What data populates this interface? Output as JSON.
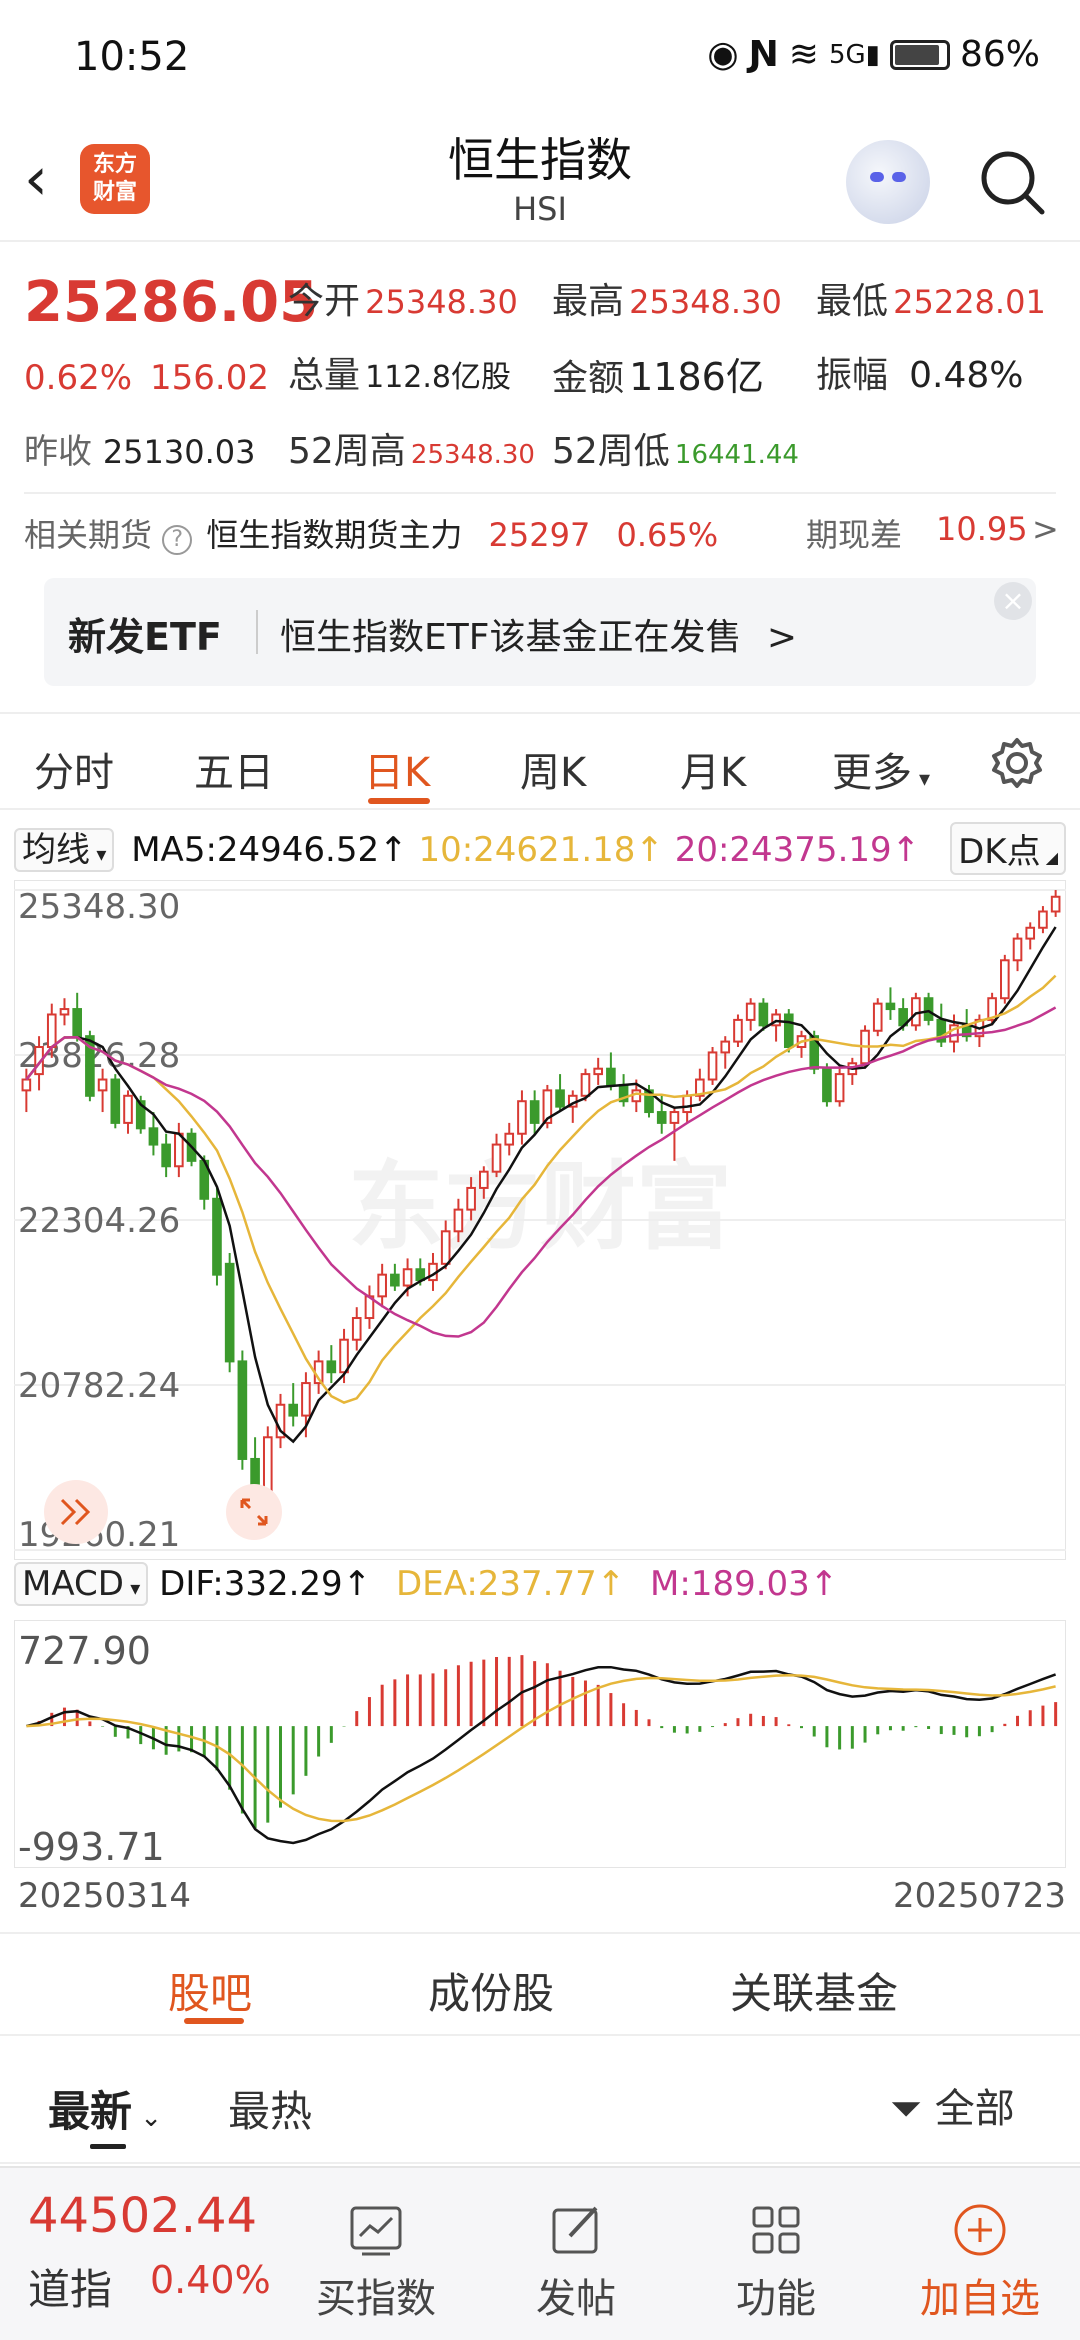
{
  "status": {
    "time": "10:52",
    "battery": "86%",
    "network": "5G"
  },
  "header": {
    "title": "恒生指数",
    "subtitle": "HSI",
    "logo_text": "东方财富"
  },
  "quote": {
    "price": "25286.05",
    "change_pct": "0.62%",
    "change": "156.02",
    "open_label": "今开",
    "open": "25348.30",
    "high_label": "最高",
    "high": "25348.30",
    "low_label": "最低",
    "low": "25228.01",
    "volume_label": "总量",
    "volume": "112.8亿股",
    "amount_label": "金额",
    "amount": "1186亿",
    "amplitude_label": "振幅",
    "amplitude": "0.48%",
    "prev_close_label": "昨收",
    "prev_close": "25130.03",
    "w52_high_label": "52周高",
    "w52_high": "25348.30",
    "w52_low_label": "52周低",
    "w52_low": "16441.44"
  },
  "futures": {
    "label": "相关期货",
    "name": "恒生指数期货主力",
    "price": "25297",
    "pct": "0.65%",
    "basis_label": "期现差",
    "basis": "10.95"
  },
  "etf": {
    "tag": "新发ETF",
    "text": "恒生指数ETF该基金正在发售",
    "arrow": ">"
  },
  "tabs": {
    "items": [
      "分时",
      "五日",
      "日K",
      "周K",
      "月K",
      "更多"
    ],
    "active": "日K"
  },
  "ma": {
    "selector": "均线",
    "ma5": "MA5:24946.52↑",
    "ma10": "10:24621.18↑",
    "ma20": "20:24375.19↑",
    "dk": "DK点",
    "colors": {
      "ma5": "#111111",
      "ma10": "#e6b63a",
      "ma20": "#c2378f"
    }
  },
  "macd": {
    "selector": "MACD",
    "dif": "DIF:332.29↑",
    "dea": "DEA:237.77↑",
    "m": "M:189.03↑"
  },
  "chart_data": [
    {
      "type": "candlestick",
      "title": "",
      "ytick_labels": [
        "25348.30",
        "23826.28",
        "22304.26",
        "20782.24",
        "19260.21"
      ],
      "ylim": [
        19260.21,
        25348.3
      ],
      "x_start": "20250314",
      "x_end": "20250723",
      "watermark": "东方财富",
      "ohlc": [
        [
          23500,
          23700,
          23300,
          23600
        ],
        [
          23650,
          24000,
          23500,
          23900
        ],
        [
          23900,
          24300,
          23800,
          24200
        ],
        [
          24200,
          24350,
          24100,
          24250
        ],
        [
          24250,
          24400,
          23950,
          24000
        ],
        [
          24000,
          24050,
          23400,
          23450
        ],
        [
          23500,
          23700,
          23300,
          23600
        ],
        [
          23600,
          23650,
          23150,
          23200
        ],
        [
          23200,
          23500,
          23100,
          23450
        ],
        [
          23400,
          23450,
          23100,
          23150
        ],
        [
          23150,
          23300,
          22900,
          23000
        ],
        [
          23000,
          23100,
          22700,
          22800
        ],
        [
          22800,
          23200,
          22700,
          23100
        ],
        [
          23100,
          23150,
          22800,
          22850
        ],
        [
          22850,
          22900,
          22400,
          22500
        ],
        [
          22500,
          22600,
          21700,
          21800
        ],
        [
          21900,
          22000,
          20900,
          21000
        ],
        [
          21000,
          21100,
          20000,
          20100
        ],
        [
          20100,
          20300,
          19700,
          19800
        ],
        [
          19800,
          20400,
          19400,
          20300
        ],
        [
          20300,
          20700,
          20200,
          20600
        ],
        [
          20600,
          20800,
          20400,
          20500
        ],
        [
          20500,
          20900,
          20300,
          20800
        ],
        [
          20800,
          21100,
          20700,
          21000
        ],
        [
          21000,
          21150,
          20800,
          20900
        ],
        [
          20900,
          21300,
          20800,
          21200
        ],
        [
          21200,
          21500,
          21100,
          21400
        ],
        [
          21400,
          21700,
          21300,
          21600
        ],
        [
          21600,
          21900,
          21500,
          21800
        ],
        [
          21800,
          21900,
          21650,
          21700
        ],
        [
          21700,
          21950,
          21600,
          21850
        ],
        [
          21850,
          21950,
          21700,
          21750
        ],
        [
          21750,
          22000,
          21650,
          21900
        ],
        [
          21900,
          22300,
          21850,
          22200
        ],
        [
          22200,
          22500,
          22100,
          22400
        ],
        [
          22400,
          22700,
          22300,
          22600
        ],
        [
          22600,
          22800,
          22500,
          22750
        ],
        [
          22750,
          23100,
          22700,
          23000
        ],
        [
          23000,
          23200,
          22900,
          23100
        ],
        [
          23100,
          23500,
          23000,
          23400
        ],
        [
          23400,
          23500,
          23100,
          23200
        ],
        [
          23200,
          23550,
          23150,
          23500
        ],
        [
          23500,
          23650,
          23300,
          23350
        ],
        [
          23350,
          23500,
          23200,
          23450
        ],
        [
          23450,
          23700,
          23400,
          23650
        ],
        [
          23650,
          23800,
          23550,
          23700
        ],
        [
          23700,
          23850,
          23500,
          23550
        ],
        [
          23550,
          23650,
          23350,
          23400
        ],
        [
          23400,
          23600,
          23300,
          23500
        ],
        [
          23500,
          23550,
          23250,
          23300
        ],
        [
          23300,
          23450,
          23100,
          23200
        ],
        [
          23200,
          23350,
          22850,
          23300
        ],
        [
          23300,
          23500,
          23200,
          23450
        ],
        [
          23450,
          23700,
          23400,
          23600
        ],
        [
          23600,
          23900,
          23550,
          23850
        ],
        [
          23850,
          24000,
          23700,
          23950
        ],
        [
          23950,
          24200,
          23900,
          24150
        ],
        [
          24150,
          24350,
          24050,
          24300
        ],
        [
          24300,
          24350,
          24050,
          24100
        ],
        [
          24100,
          24250,
          23950,
          24200
        ],
        [
          24200,
          24250,
          23850,
          23900
        ],
        [
          23900,
          24050,
          23800,
          24000
        ],
        [
          24000,
          24050,
          23650,
          23700
        ],
        [
          23700,
          23750,
          23350,
          23400
        ],
        [
          23400,
          23700,
          23350,
          23650
        ],
        [
          23650,
          23800,
          23550,
          23750
        ],
        [
          23750,
          24100,
          23700,
          24050
        ],
        [
          24050,
          24350,
          24000,
          24300
        ],
        [
          24300,
          24450,
          24150,
          24250
        ],
        [
          24250,
          24350,
          24050,
          24100
        ],
        [
          24100,
          24400,
          24050,
          24350
        ],
        [
          24350,
          24400,
          24100,
          24150
        ],
        [
          24150,
          24300,
          23900,
          23950
        ],
        [
          23950,
          24200,
          23850,
          24100
        ],
        [
          24100,
          24250,
          23950,
          24000
        ],
        [
          24000,
          24200,
          23900,
          24150
        ],
        [
          24150,
          24400,
          24100,
          24350
        ],
        [
          24350,
          24750,
          24300,
          24700
        ],
        [
          24700,
          24950,
          24600,
          24900
        ],
        [
          24900,
          25050,
          24800,
          25000
        ],
        [
          25000,
          25200,
          24950,
          25150
        ],
        [
          25150,
          25348,
          25100,
          25286
        ]
      ]
    },
    {
      "type": "bar",
      "title": "",
      "ytick_labels": [
        "727.90",
        "-993.71"
      ],
      "ylim": [
        -993.71,
        727.9
      ]
    }
  ],
  "bottom_tabs": {
    "items": [
      "股吧",
      "成份股",
      "关联基金"
    ],
    "active": "股吧"
  },
  "filter": {
    "latest": "最新",
    "hot": "最热",
    "all": "全部"
  },
  "bottom_bar": {
    "index_value": "44502.44",
    "index_name": "道指",
    "index_pct": "0.40%",
    "buy": "买指数",
    "post": "发帖",
    "func": "功能",
    "add": "加自选"
  }
}
